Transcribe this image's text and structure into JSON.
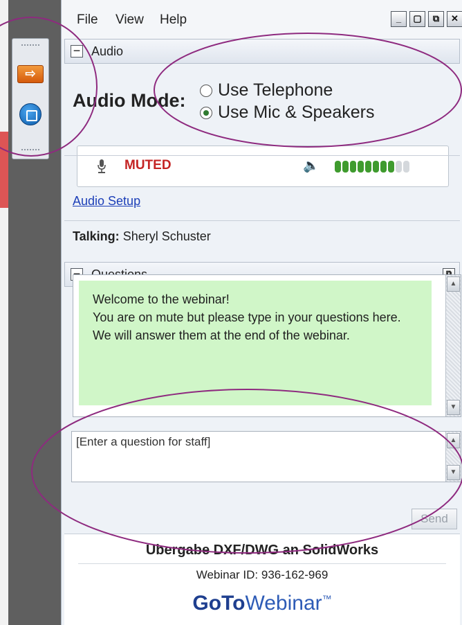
{
  "menu": {
    "file": "File",
    "view": "View",
    "help": "Help"
  },
  "window_controls": {
    "minimize": "_",
    "restore": "▢",
    "popout": "⧉",
    "close": "✕"
  },
  "audio": {
    "header": "Audio",
    "mode_label": "Audio Mode:",
    "options": [
      {
        "label": "Use Telephone",
        "selected": false
      },
      {
        "label": "Use Mic & Speakers",
        "selected": true
      }
    ],
    "mute_status": "MUTED",
    "volume_level": 0.8,
    "setup_link": "Audio Setup",
    "talking_label": "Talking:",
    "talking_name": "Sheryl Schuster"
  },
  "questions": {
    "header": "Questions",
    "messages": [
      "Welcome to the webinar!",
      "You are on mute but please type in your questions here. We will answer them at the end of the webinar."
    ],
    "input_placeholder": "[Enter a question for staff]",
    "send_label": "Send"
  },
  "footer": {
    "webinar_title": "Ubergabe DXF/DWG an SolidWorks",
    "webinar_id": "Webinar ID: 936-162-969",
    "brand_bold": "GoTo",
    "brand_light": "Webinar",
    "brand_tm": "™"
  },
  "colors": {
    "annotation": "#8e2a7f",
    "muted": "#c42424",
    "link": "#1c3fb8",
    "message_bg": "#d0f6c8",
    "level_on": "#3f9b2e"
  },
  "icons": [
    "arrow-right-icon",
    "stop-icon",
    "minus-icon",
    "mic-icon",
    "speaker-icon",
    "popout-icon"
  ]
}
